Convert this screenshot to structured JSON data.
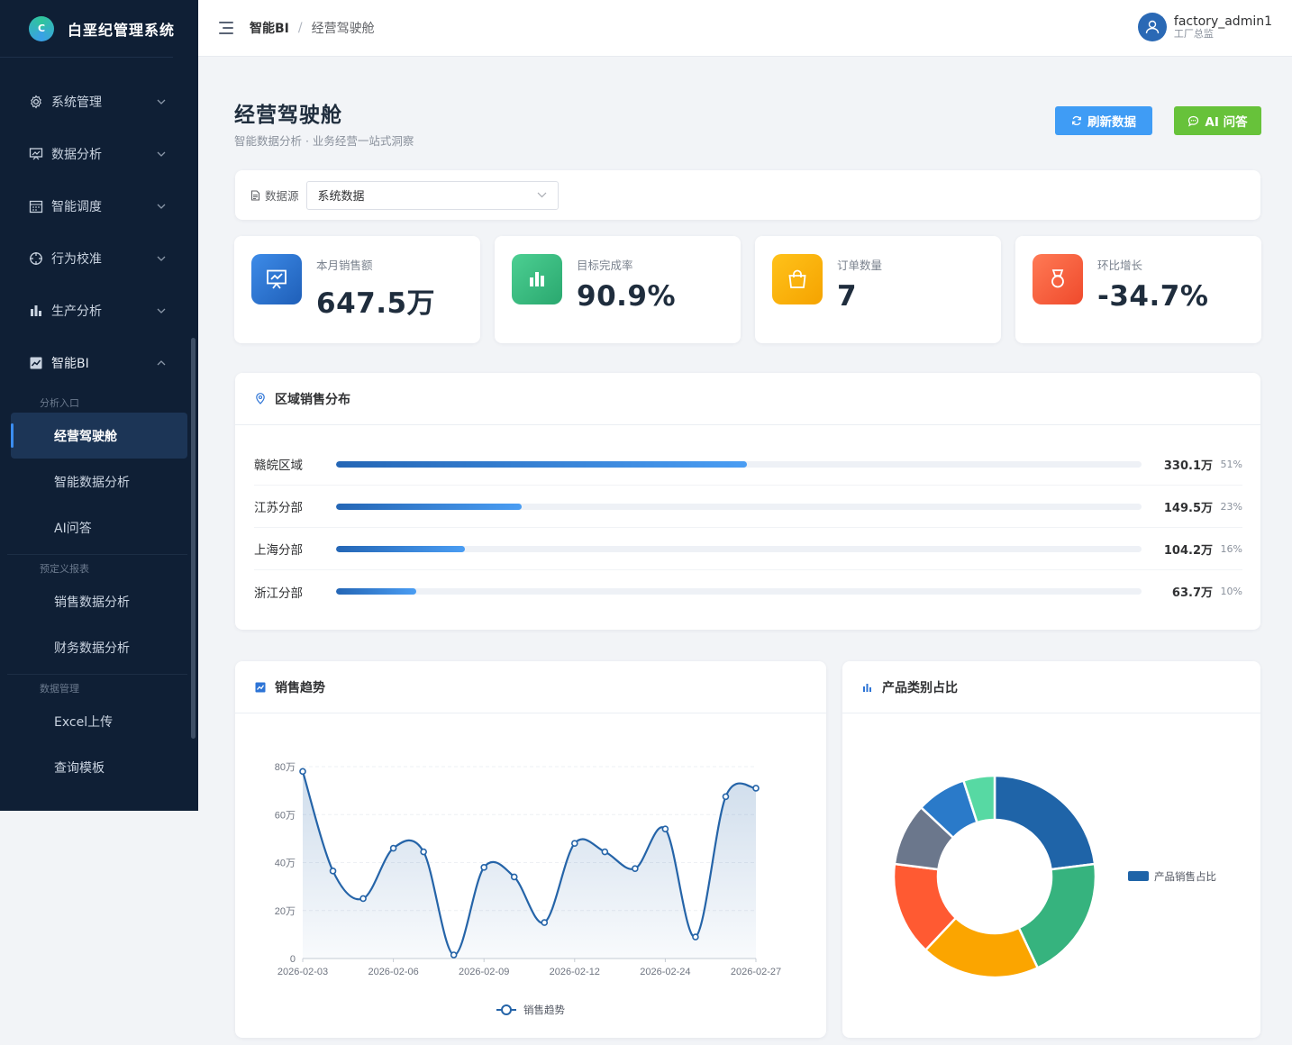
{
  "sidebar": {
    "brand_logo": "C",
    "brand_title": "白垩纪管理系统",
    "menu": [
      {
        "label": "系统管理",
        "icon": "gear-icon"
      },
      {
        "label": "数据分析",
        "icon": "presentation-icon"
      },
      {
        "label": "智能调度",
        "icon": "calendar-icon"
      },
      {
        "label": "行为校准",
        "icon": "target-icon"
      },
      {
        "label": "生产分析",
        "icon": "bar-chart-icon"
      }
    ],
    "bi_menu": {
      "label": "智能BI",
      "icon": "line-chart-icon"
    },
    "groups": [
      {
        "label": "分析入口",
        "items": [
          "经营驾驶舱",
          "智能数据分析",
          "AI问答"
        ]
      },
      {
        "label": "预定义报表",
        "items": [
          "销售数据分析",
          "财务数据分析"
        ]
      },
      {
        "label": "数据管理",
        "items": [
          "Excel上传",
          "查询模板"
        ]
      }
    ]
  },
  "header": {
    "breadcrumb_root": "智能BI",
    "breadcrumb_sep": "/",
    "breadcrumb_current": "经营驾驶舱",
    "user_name": "factory_admin1",
    "user_role": "工厂总监"
  },
  "page": {
    "title": "经营驾驶舱",
    "subtitle": "智能数据分析 · 业务经营一站式洞察",
    "refresh_label": "刷新数据",
    "ai_label": "AI 问答"
  },
  "filter": {
    "label": "数据源",
    "value": "系统数据"
  },
  "kpis": [
    {
      "label": "本月销售额",
      "value": "647.5万",
      "icon": "presentation-icon",
      "color": "#2d74d6"
    },
    {
      "label": "目标完成率",
      "value": "90.9%",
      "icon": "bar-chart-icon",
      "color": "#36b37e"
    },
    {
      "label": "订单数量",
      "value": "7",
      "icon": "shopping-bag-icon",
      "color": "#f5a700"
    },
    {
      "label": "环比增长",
      "value": "-34.7%",
      "icon": "medal-icon",
      "color": "#f25a3b"
    }
  ],
  "region": {
    "title": "区域销售分布",
    "rows": [
      {
        "name": "赣皖区域",
        "value": "330.1万",
        "pct": "51%",
        "ratio": 0.51
      },
      {
        "name": "江苏分部",
        "value": "149.5万",
        "pct": "23%",
        "ratio": 0.23
      },
      {
        "name": "上海分部",
        "value": "104.2万",
        "pct": "16%",
        "ratio": 0.16
      },
      {
        "name": "浙江分部",
        "value": "63.7万",
        "pct": "10%",
        "ratio": 0.1
      }
    ]
  },
  "trend": {
    "title": "销售趋势",
    "legend": "销售趋势",
    "y_ticks": [
      "0",
      "20万",
      "40万",
      "60万",
      "80万"
    ],
    "x_labels": [
      "2026-02-03",
      "2026-02-06",
      "2026-02-09",
      "2026-02-12",
      "2026-02-24",
      "2026-02-27"
    ],
    "line_color": "#2564a8"
  },
  "pie": {
    "title": "产品类别占比",
    "legend": "产品销售占比"
  },
  "chart_data": [
    {
      "type": "area",
      "title": "销售趋势",
      "ylim": [
        0,
        800000
      ],
      "y_ticks": [
        0,
        200000,
        400000,
        600000,
        800000
      ],
      "x_tick_labels": [
        "2026-02-03",
        "2026-02-06",
        "2026-02-09",
        "2026-02-12",
        "2026-02-24",
        "2026-02-27"
      ],
      "series": [
        {
          "name": "销售趋势",
          "values": [
            780000,
            365000,
            250000,
            460000,
            445000,
            15000,
            380000,
            340000,
            150000,
            480000,
            445000,
            375000,
            540000,
            90000,
            675000,
            710000
          ]
        }
      ],
      "grid": true,
      "legend_position": "bottom"
    },
    {
      "type": "pie",
      "title": "产品类别占比",
      "series_name": "产品销售占比",
      "slices": [
        {
          "value": 0.23,
          "color": "#1f64a8"
        },
        {
          "value": 0.2,
          "color": "#36b37e"
        },
        {
          "value": 0.19,
          "color": "#fba500"
        },
        {
          "value": 0.15,
          "color": "#ff5a32"
        },
        {
          "value": 0.1,
          "color": "#6b778c"
        },
        {
          "value": 0.08,
          "color": "#2a7ac9"
        },
        {
          "value": 0.05,
          "color": "#57d9a3"
        }
      ],
      "donut": true,
      "legend_position": "right"
    }
  ]
}
